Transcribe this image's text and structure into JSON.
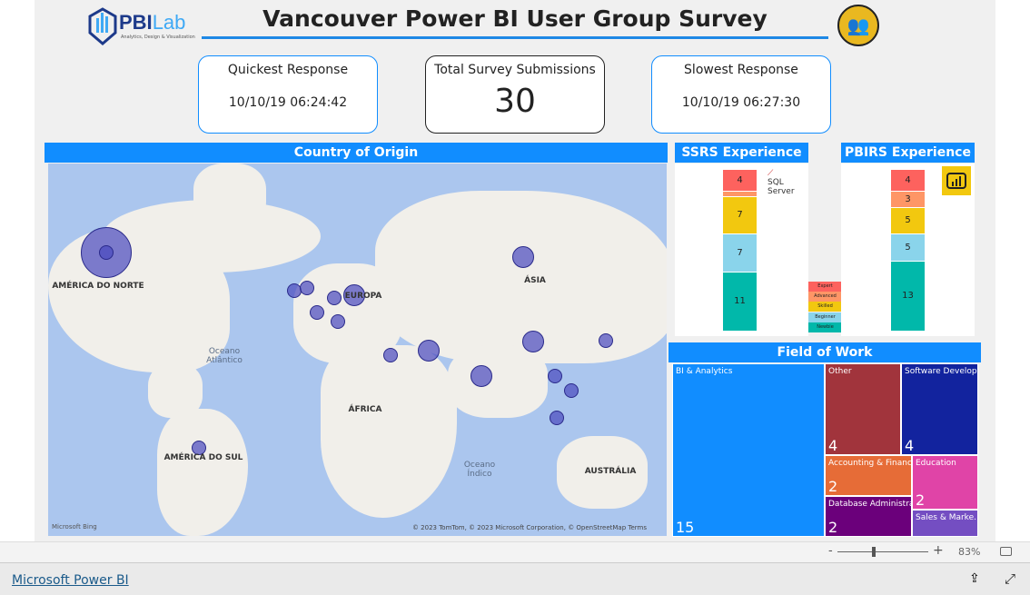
{
  "header": {
    "title": "Vancouver Power BI User Group Survey",
    "logo_text": "PBILab",
    "logo_subtitle": "Analytics, Design & Visualization"
  },
  "cards": [
    {
      "label": "Quickest Response",
      "value": "10/10/19 06:24:42"
    },
    {
      "label": "Total Survey Submissions",
      "value": "30"
    },
    {
      "label": "Slowest Response",
      "value": "10/10/19 06:27:30"
    }
  ],
  "map": {
    "title": "Country of Origin",
    "labels": [
      "AMÉRICA DO NORTE",
      "EUROPA",
      "ÁSIA",
      "ÁFRICA",
      "AMÉRICA DO SUL",
      "AUSTRÁLIA"
    ],
    "oceans": [
      "Oceano Atlântico",
      "Oceano Índico"
    ],
    "attribution": "© 2023 TomTom, © 2023 Microsoft Corporation, © OpenStreetMap  Terms",
    "provider": "Microsoft Bing",
    "bubble_color": "#4848be"
  },
  "ssrs": {
    "title": "SSRS Experience",
    "logo": "SQL Server",
    "segments": [
      {
        "level": "Expert",
        "value": 4,
        "color": "#fd625e"
      },
      {
        "level": "Advanced",
        "value": 1,
        "color": "#fe9666"
      },
      {
        "level": "Skilled",
        "value": 7,
        "color": "#f2c80f"
      },
      {
        "level": "Beginner",
        "value": 7,
        "color": "#8ad4eb"
      },
      {
        "level": "Newbie",
        "value": 11,
        "color": "#01b8aa"
      }
    ]
  },
  "pbirs": {
    "title": "PBIRS Experience",
    "segments": [
      {
        "level": "Expert",
        "value": 4,
        "color": "#fd625e"
      },
      {
        "level": "Advanced",
        "value": 3,
        "color": "#fe9666"
      },
      {
        "level": "Skilled",
        "value": 5,
        "color": "#f2c80f"
      },
      {
        "level": "Beginner",
        "value": 5,
        "color": "#8ad4eb"
      },
      {
        "level": "Newbie",
        "value": 13,
        "color": "#01b8aa"
      }
    ]
  },
  "legend": [
    "Expert",
    "Advanced",
    "Skilled",
    "Beginner",
    "Newbie"
  ],
  "field": {
    "title": "Field of Work",
    "items": [
      {
        "name": "BI & Analytics",
        "value": 15,
        "color": "#118dff"
      },
      {
        "name": "Other",
        "value": 4,
        "color": "#a1343c"
      },
      {
        "name": "Software Develop...",
        "value": 4,
        "color": "#12239e"
      },
      {
        "name": "Accounting & Finance",
        "value": 2,
        "color": "#e66c37"
      },
      {
        "name": "Education",
        "value": 2,
        "color": "#e044a7"
      },
      {
        "name": "Database Administra...",
        "value": 2,
        "color": "#6b007b"
      },
      {
        "name": "Sales & Marke...",
        "value": 1,
        "color": "#744ec2"
      }
    ]
  },
  "zoom": {
    "minus": "-",
    "plus": "+",
    "level": "83%",
    "value_percent": 83
  },
  "footer": {
    "link": "Microsoft Power BI"
  }
}
